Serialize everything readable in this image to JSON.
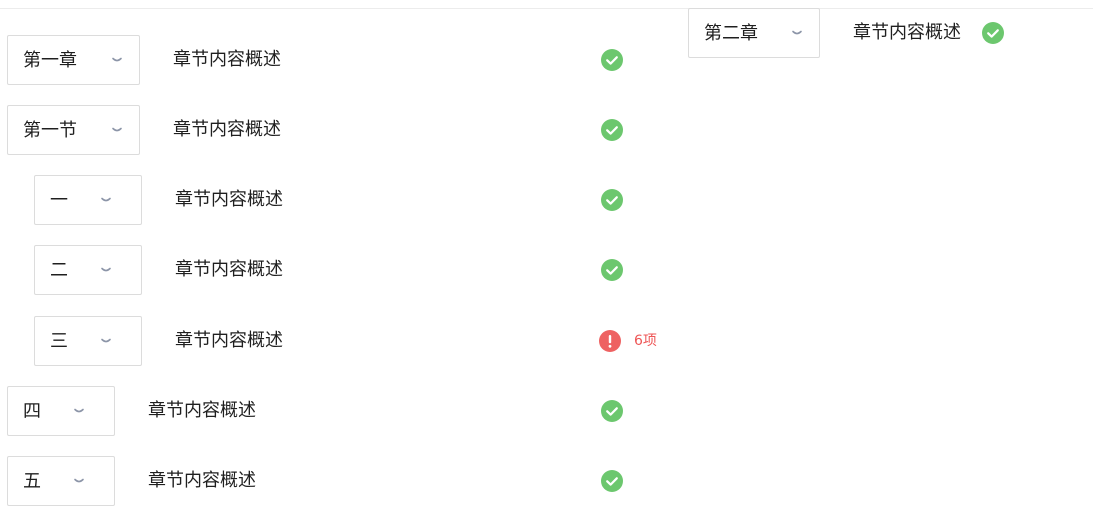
{
  "colors": {
    "success": "#6cc76e",
    "error": "#ee6262",
    "chevron": "#8c95a8",
    "border": "#dcdcdc"
  },
  "right_panel": {
    "select": "第二章",
    "description": "章节内容概述",
    "status": "success"
  },
  "rows": [
    {
      "select": "第一章",
      "description": "章节内容概述",
      "status": "success"
    },
    {
      "select": "第一节",
      "description": "章节内容概述",
      "status": "success"
    },
    {
      "select": "一",
      "description": "章节内容概述",
      "status": "success"
    },
    {
      "select": "二",
      "description": "章节内容概述",
      "status": "success"
    },
    {
      "select": "三",
      "description": "章节内容概述",
      "status": "error",
      "count": "6项"
    },
    {
      "select": "四",
      "description": "章节内容概述",
      "status": "success"
    },
    {
      "select": "五",
      "description": "章节内容概述",
      "status": "success"
    }
  ],
  "icons": {
    "success": "check-circle-icon",
    "error": "exclamation-circle-icon",
    "dropdown": "chevron-down-icon"
  }
}
